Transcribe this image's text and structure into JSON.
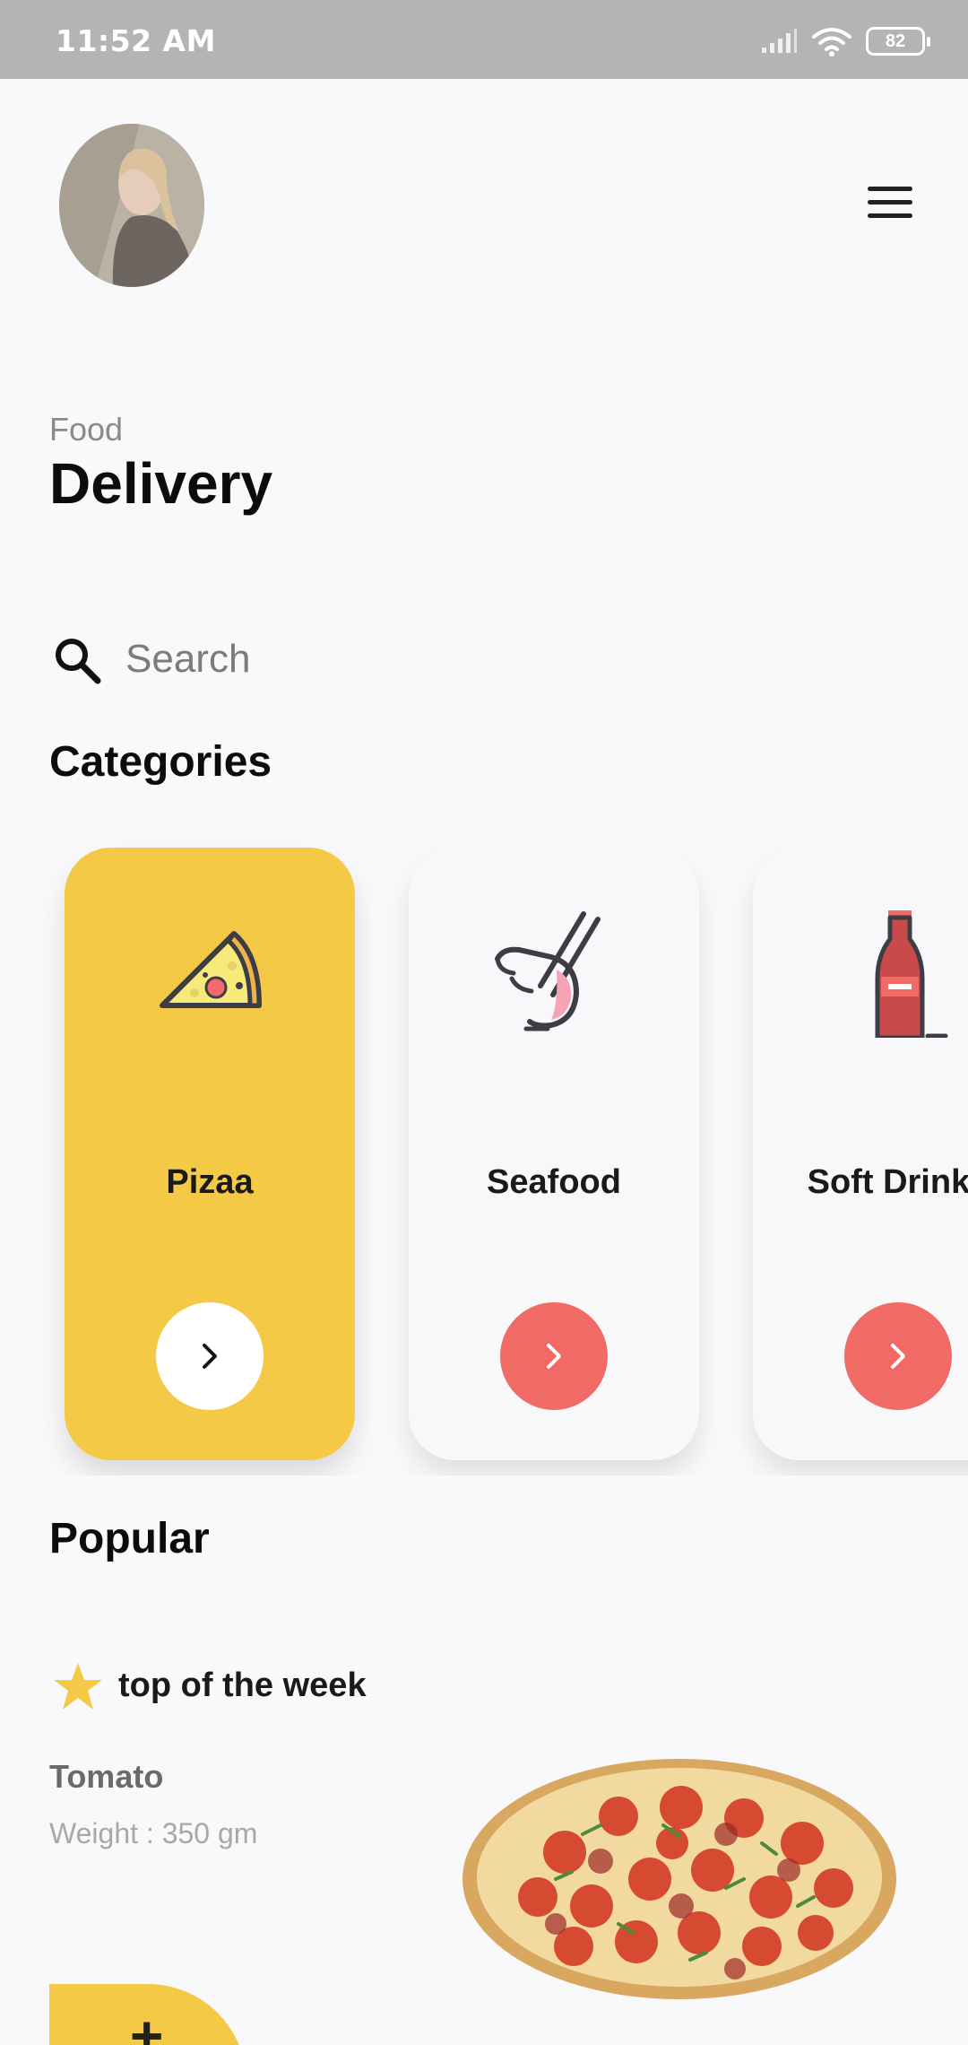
{
  "status_bar": {
    "time": "11:52 AM",
    "battery": "82"
  },
  "header": {
    "subtitle": "Food",
    "title": "Delivery"
  },
  "search": {
    "placeholder": "Search"
  },
  "categories": {
    "title": "Categories",
    "items": [
      {
        "label": "Pizaa",
        "icon": "pizza-icon",
        "active": true
      },
      {
        "label": "Seafood",
        "icon": "shrimp-chopsticks-icon",
        "active": false
      },
      {
        "label": "Soft Drinks",
        "icon": "soda-bottle-icon",
        "active": false
      }
    ]
  },
  "popular": {
    "title": "Popular",
    "badge": "top of the week",
    "item": {
      "name": "Tomato",
      "weight": "Weight : 350 gm"
    },
    "add_label": "+"
  },
  "colors": {
    "accent": "#f4c946",
    "arrow": "#f06a66",
    "background": "#f9f9fb"
  }
}
